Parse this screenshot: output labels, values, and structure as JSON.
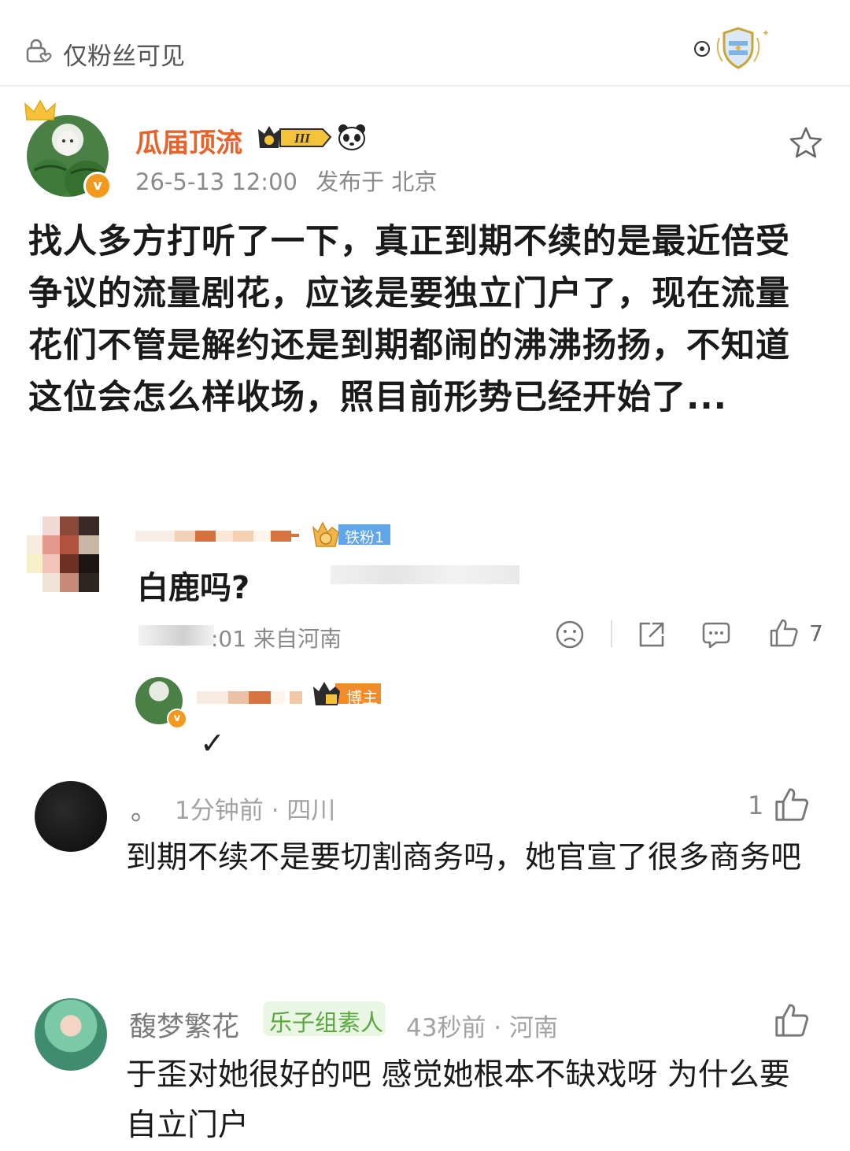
{
  "topbar": {
    "visibility_text": "仅粉丝可见"
  },
  "post": {
    "author": "瓜届顶流",
    "level_badge": "III",
    "verified_mark": "v",
    "date": "26-5-13 12:00",
    "location": "发布于 北京",
    "body": "找人多方打听了一下，真正到期不续的是最近倍受争议的流量剧花，应该是要独立门户了，现在流量花们不管是解约还是到期都闹的沸沸扬扬，不知道这位会怎么样收场，照目前形势已经开始了..."
  },
  "comments": [
    {
      "fan_badge": "铁粉1",
      "text": "白鹿吗?",
      "meta_visible": ":01 来自河南",
      "like_count": "7",
      "reply": {
        "badge": "博主",
        "text": "✓"
      }
    },
    {
      "name": "。",
      "meta": "1分钟前 · 四川",
      "like_count": "1",
      "text": "到期不续不是要切割商务吗，她官宣了很多商务吧"
    },
    {
      "name": "馥梦繁花",
      "tag": "乐子组素人",
      "meta": "43秒前 · 河南",
      "text": "于歪对她很好的吧 感觉她根本不缺戏呀 为什么要自立门户"
    }
  ],
  "colors": {
    "author": "#e8632b",
    "vip_orange": "#f29a1d",
    "fan_badge": "#5fa6ea",
    "tag_green": "#5aa83d"
  }
}
